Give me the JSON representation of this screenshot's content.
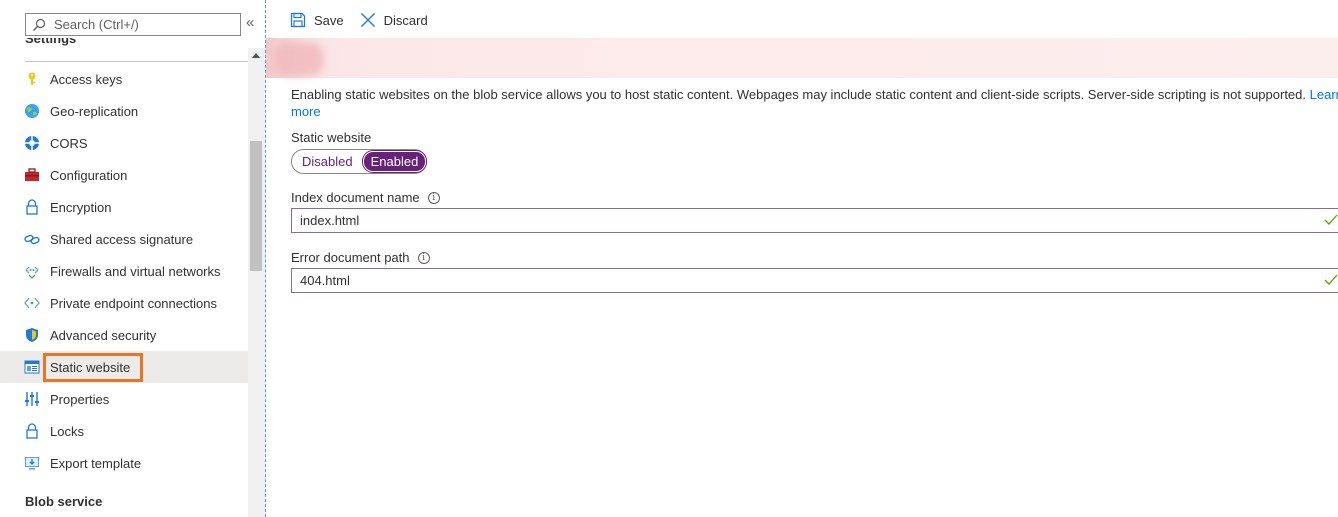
{
  "sidebar": {
    "search_placeholder": "Search (Ctrl+/)",
    "collapse_glyph": "«",
    "section_heading": "Settings",
    "items": [
      {
        "label": "Access keys",
        "icon": "key-icon"
      },
      {
        "label": "Geo-replication",
        "icon": "globe-icon"
      },
      {
        "label": "CORS",
        "icon": "cors-icon"
      },
      {
        "label": "Configuration",
        "icon": "toolbox-icon"
      },
      {
        "label": "Encryption",
        "icon": "lock-icon"
      },
      {
        "label": "Shared access signature",
        "icon": "link-icon"
      },
      {
        "label": "Firewalls and virtual networks",
        "icon": "network-icon"
      },
      {
        "label": "Private endpoint connections",
        "icon": "endpoint-icon"
      },
      {
        "label": "Advanced security",
        "icon": "shield-icon"
      },
      {
        "label": "Static website",
        "icon": "website-icon",
        "selected": true
      },
      {
        "label": "Properties",
        "icon": "properties-icon"
      },
      {
        "label": "Locks",
        "icon": "lock-icon"
      },
      {
        "label": "Export template",
        "icon": "export-icon"
      }
    ],
    "blob_heading": "Blob service"
  },
  "toolbar": {
    "save_label": "Save",
    "discard_label": "Discard"
  },
  "main": {
    "description": "Enabling static websites on the blob service allows you to host static content. Webpages may include static content and client-side scripts. Server-side scripting is not supported.",
    "learn_more_part1": "Learn",
    "learn_more_part2": "more",
    "static_website_label": "Static website",
    "toggle": {
      "disabled_label": "Disabled",
      "enabled_label": "Enabled",
      "value": "Enabled"
    },
    "index_label": "Index document name",
    "index_value": "index.html",
    "error_label": "Error document path",
    "error_value": "404.html"
  },
  "colors": {
    "accent_purple": "#68217a",
    "selection_orange": "#e97526",
    "link_blue": "#0078d4",
    "valid_green": "#57a300"
  }
}
